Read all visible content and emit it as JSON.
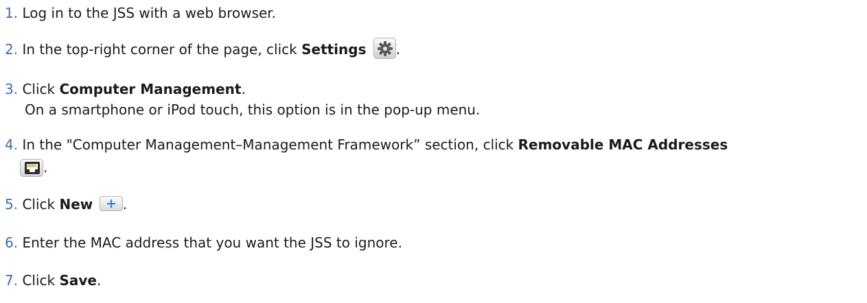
{
  "steps": [
    {
      "num": "1.",
      "text": "Log in to the JSS with a web browser."
    },
    {
      "num": "2.",
      "pre": "In the top-right corner of the page, click ",
      "bold": "Settings",
      "icon": "gear-icon",
      "post": "."
    },
    {
      "num": "3.",
      "pre": "Click ",
      "bold": "Computer Management",
      "post": ".",
      "sub": "On a smartphone or iPod touch, this option is in the pop-up menu."
    },
    {
      "num": "4.",
      "pre": "In the \"Computer Management–Management Framework” section, click ",
      "bold": "Removable MAC Addresses",
      "icon": "network-port-icon",
      "post": "."
    },
    {
      "num": "5.",
      "pre": "Click ",
      "bold": "New",
      "icon": "plus-icon",
      "post": "."
    },
    {
      "num": "6.",
      "text": "Enter the MAC address that you want the JSS to ignore."
    },
    {
      "num": "7.",
      "pre": "Click ",
      "bold": "Save",
      "post": "."
    }
  ]
}
